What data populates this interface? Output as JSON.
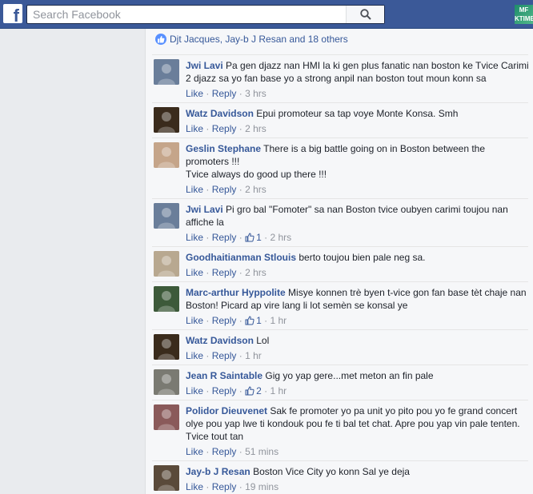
{
  "search": {
    "placeholder": "Search Facebook"
  },
  "topbar": {
    "logo": "f",
    "app_icon_text": "MF\nKTIME"
  },
  "likes": {
    "names": "Djt Jacques, Jay-b J Resan and 18 others"
  },
  "labels": {
    "like": "Like",
    "reply": "Reply",
    "dot": "·"
  },
  "comments": [
    {
      "name": "Jwi Lavi",
      "text": "Pa gen djazz nan HMI la ki gen plus fanatic nan boston ke Tvice Carimi 2 djazz sa yo fan base yo a strong anpil nan boston tout moun konn sa",
      "likes": "",
      "time": "3 hrs",
      "avatar_color": "#6a7e9a"
    },
    {
      "name": "Watz Davidson",
      "text": "Epui promoteur sa tap voye Monte Konsa. Smh",
      "likes": "",
      "time": "2 hrs",
      "avatar_color": "#3a2b1c"
    },
    {
      "name": "Geslin Stephane",
      "text": "There is a big battle going on in Boston between the promoters !!!\nTvice always do good up there !!!",
      "likes": "",
      "time": "2 hrs",
      "avatar_color": "#c5a58a"
    },
    {
      "name": "Jwi Lavi",
      "text": "Pi gro bal \"Fomoter\" sa nan Boston tvice oubyen carimi toujou nan affiche la",
      "likes": "1",
      "time": "2 hrs",
      "avatar_color": "#6a7e9a"
    },
    {
      "name": "Goodhaitianman Stlouis",
      "text": "berto toujou bien pale neg sa.",
      "likes": "",
      "time": "2 hrs",
      "avatar_color": "#b8a890"
    },
    {
      "name": "Marc-arthur Hyppolite",
      "text": "Misye konnen trè byen t-vice gon fan base tèt chaje nan Boston! Picard ap vire lang li lot semèn se konsal ye",
      "likes": "1",
      "time": "1 hr",
      "avatar_color": "#3d5a3a"
    },
    {
      "name": "Watz Davidson",
      "text": "Lol",
      "likes": "",
      "time": "1 hr",
      "avatar_color": "#3a2b1c"
    },
    {
      "name": "Jean R Saintable",
      "text": "Gig yo yap gere...met meton an fin pale",
      "likes": "2",
      "time": "1 hr",
      "avatar_color": "#7a7a72"
    },
    {
      "name": "Polidor Dieuvenet",
      "text": "Sak fe promoter yo pa unit yo pito pou yo fe grand concert olye pou yap lwe ti kondouk pou fe ti bal tet chat. Apre pou yap vin pale tenten. Tvice tout tan",
      "likes": "",
      "time": "51 mins",
      "avatar_color": "#8a5a5a"
    },
    {
      "name": "Jay-b J Resan",
      "text": "Boston Vice City yo konn Sal ye deja",
      "likes": "",
      "time": "19 mins",
      "avatar_color": "#5a4a3a"
    }
  ]
}
